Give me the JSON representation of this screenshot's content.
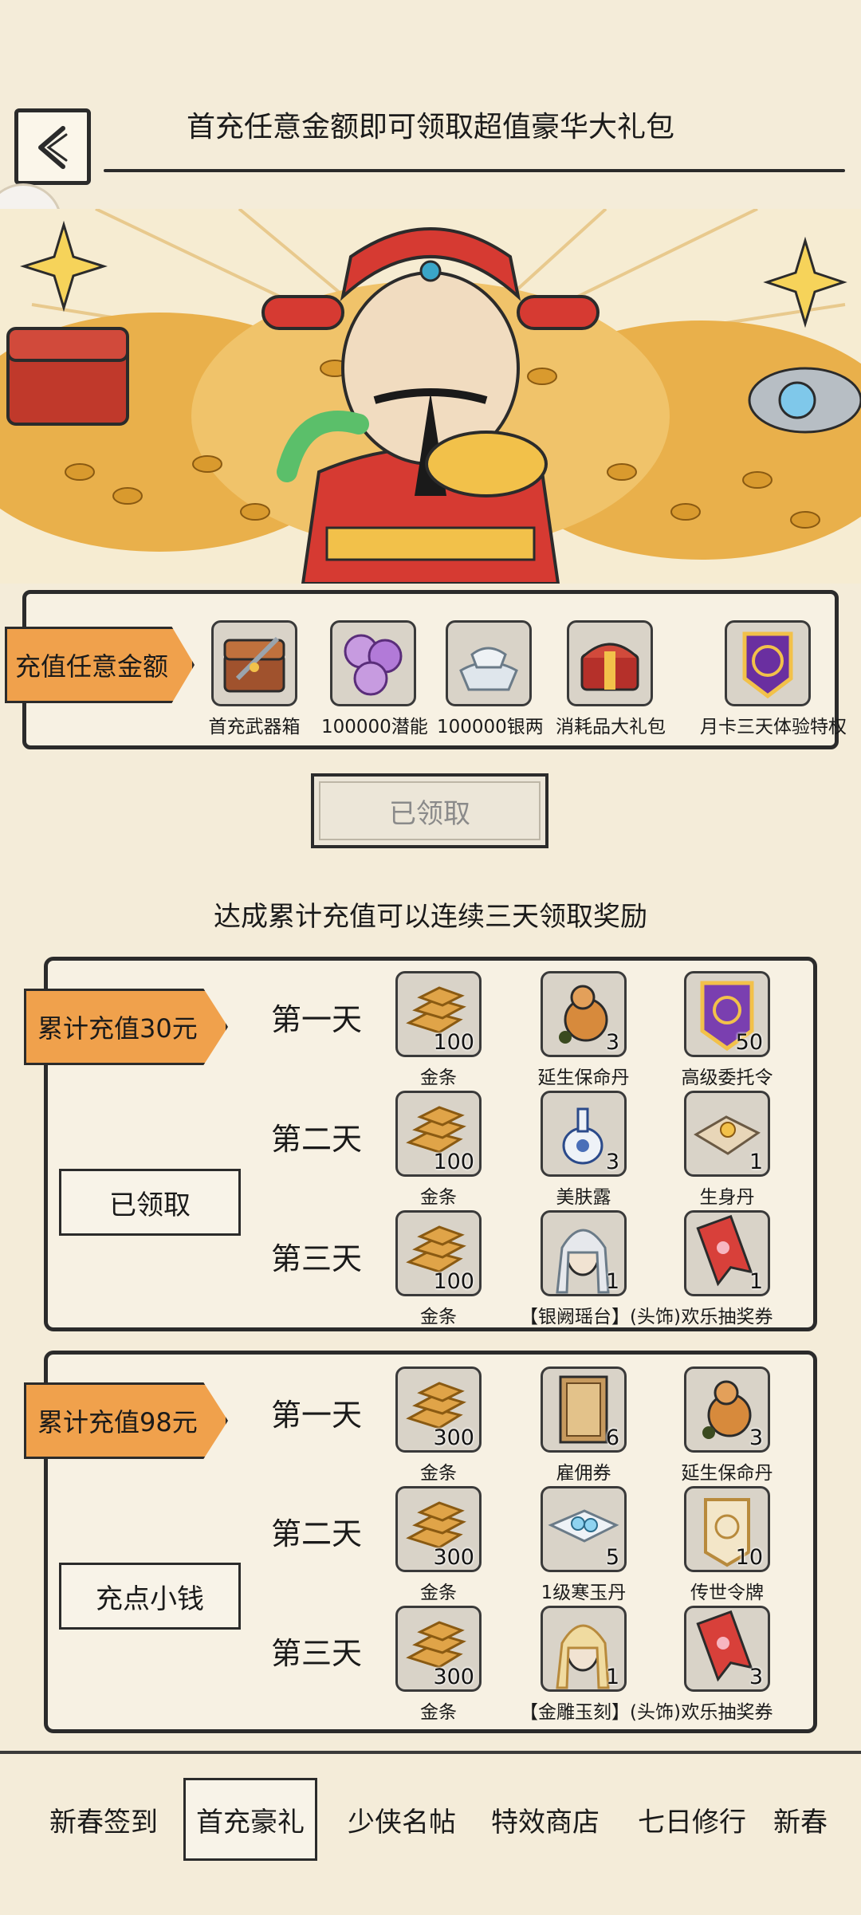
{
  "header": {
    "title": "首充任意金额即可领取超值豪华大礼包"
  },
  "first_recharge": {
    "ribbon": "充值任意金额",
    "items": [
      {
        "label": "首充武器箱",
        "icon": "weapon-chest-icon"
      },
      {
        "label": "100000潜能",
        "icon": "potential-orbs-icon"
      },
      {
        "label": "100000银两",
        "icon": "silver-ingots-icon"
      },
      {
        "label": "消耗品大礼包",
        "icon": "gift-chest-icon"
      },
      {
        "label": "月卡三天体验特权",
        "icon": "month-card-icon"
      }
    ],
    "claim_button": "已领取"
  },
  "cumulative": {
    "subtitle": "达成累计充值可以连续三天领取奖励",
    "tiers": [
      {
        "ribbon": "累计充值30元",
        "button": "已领取",
        "days": [
          {
            "label": "第一天",
            "items": [
              {
                "label": "金条",
                "qty": "100",
                "icon": "gold-bars-icon"
              },
              {
                "label": "延生保命丹",
                "qty": "3",
                "icon": "gourd-pill-icon"
              },
              {
                "label": "高级委托令",
                "qty": "50",
                "icon": "commission-token-icon"
              }
            ]
          },
          {
            "label": "第二天",
            "items": [
              {
                "label": "金条",
                "qty": "100",
                "icon": "gold-bars-icon"
              },
              {
                "label": "美肤露",
                "qty": "3",
                "icon": "porcelain-bottle-icon"
              },
              {
                "label": "生身丹",
                "qty": "1",
                "icon": "pill-on-paper-icon"
              }
            ]
          },
          {
            "label": "第三天",
            "items": [
              {
                "label": "金条",
                "qty": "100",
                "icon": "gold-bars-icon"
              },
              {
                "label": "【银阙瑶台】(头饰)",
                "qty": "1",
                "icon": "headwear-silver-icon"
              },
              {
                "label": "欢乐抽奖券",
                "qty": "1",
                "icon": "lottery-ticket-icon"
              }
            ]
          }
        ]
      },
      {
        "ribbon": "累计充值98元",
        "button": "充点小钱",
        "days": [
          {
            "label": "第一天",
            "items": [
              {
                "label": "金条",
                "qty": "300",
                "icon": "gold-bars-icon"
              },
              {
                "label": "雇佣券",
                "qty": "6",
                "icon": "hire-scroll-icon"
              },
              {
                "label": "延生保命丹",
                "qty": "3",
                "icon": "gourd-pill-icon"
              }
            ]
          },
          {
            "label": "第二天",
            "items": [
              {
                "label": "金条",
                "qty": "300",
                "icon": "gold-bars-icon"
              },
              {
                "label": "1级寒玉丹",
                "qty": "5",
                "icon": "jade-pill-icon"
              },
              {
                "label": "传世令牌",
                "qty": "10",
                "icon": "heirloom-token-icon"
              }
            ]
          },
          {
            "label": "第三天",
            "items": [
              {
                "label": "金条",
                "qty": "300",
                "icon": "gold-bars-icon"
              },
              {
                "label": "【金雕玉刻】(头饰)",
                "qty": "1",
                "icon": "headwear-gold-icon"
              },
              {
                "label": "欢乐抽奖券",
                "qty": "3",
                "icon": "lottery-ticket-icon"
              }
            ]
          }
        ]
      }
    ]
  },
  "tabs": [
    {
      "label": "新春签到",
      "active": false
    },
    {
      "label": "首充豪礼",
      "active": true
    },
    {
      "label": "少侠名帖",
      "active": false
    },
    {
      "label": "特效商店",
      "active": false
    },
    {
      "label": "七日修行",
      "active": false
    },
    {
      "label": "新春",
      "active": false
    }
  ]
}
